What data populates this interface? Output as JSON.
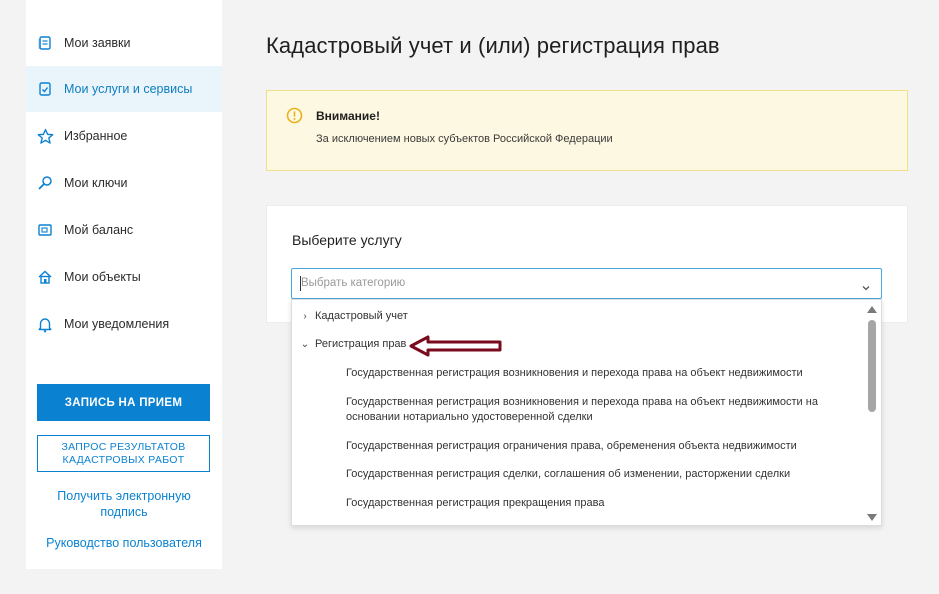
{
  "sidebar": {
    "items": [
      {
        "label": "Мои заявки",
        "icon": "document-icon"
      },
      {
        "label": "Мои услуги и сервисы",
        "icon": "checklist-icon",
        "active": true
      },
      {
        "label": "Избранное",
        "icon": "star-icon"
      },
      {
        "label": "Мои ключи",
        "icon": "key-icon"
      },
      {
        "label": "Мой баланс",
        "icon": "wallet-icon"
      },
      {
        "label": "Мои объекты",
        "icon": "house-icon"
      },
      {
        "label": "Мои уведомления",
        "icon": "bell-icon"
      }
    ],
    "appointment_button": "ЗАПИСЬ НА ПРИЕМ",
    "cadastral_results_button": "ЗАПРОС РЕЗУЛЬТАТОВ КАДАСТРОВЫХ РАБОТ",
    "signature_link": "Получить электронную подпись",
    "guide_link": "Руководство пользователя"
  },
  "main": {
    "title": "Кадастровый учет и (или) регистрация прав",
    "alert": {
      "title": "Внимание!",
      "text": "За исключением новых субъектов Российской Федерации",
      "icon": "warning-circle-icon"
    },
    "service_card": {
      "title": "Выберите услугу",
      "select_placeholder": "Выбрать категорию"
    },
    "dropdown": {
      "categories": [
        {
          "label": "Кадастровый учет",
          "expanded": false
        },
        {
          "label": "Регистрация прав",
          "expanded": true
        }
      ],
      "services": [
        "Государственная регистрация возникновения и перехода права на объект недвижимости",
        "Государственная регистрация возникновения и перехода права на объект недвижимости на основании нотариально удостоверенной сделки",
        "Государственная регистрация ограничения права, обременения объекта недвижимости",
        "Государственная регистрация сделки, соглашения об изменении, расторжении сделки",
        "Государственная регистрация прекращения права"
      ]
    }
  },
  "colors": {
    "accent": "#0b82d1",
    "active_bg": "#eaf4fb",
    "alert_bg": "#fdf8e1",
    "alert_border": "#f2df8b",
    "annotation_arrow": "#7a0b1c"
  }
}
